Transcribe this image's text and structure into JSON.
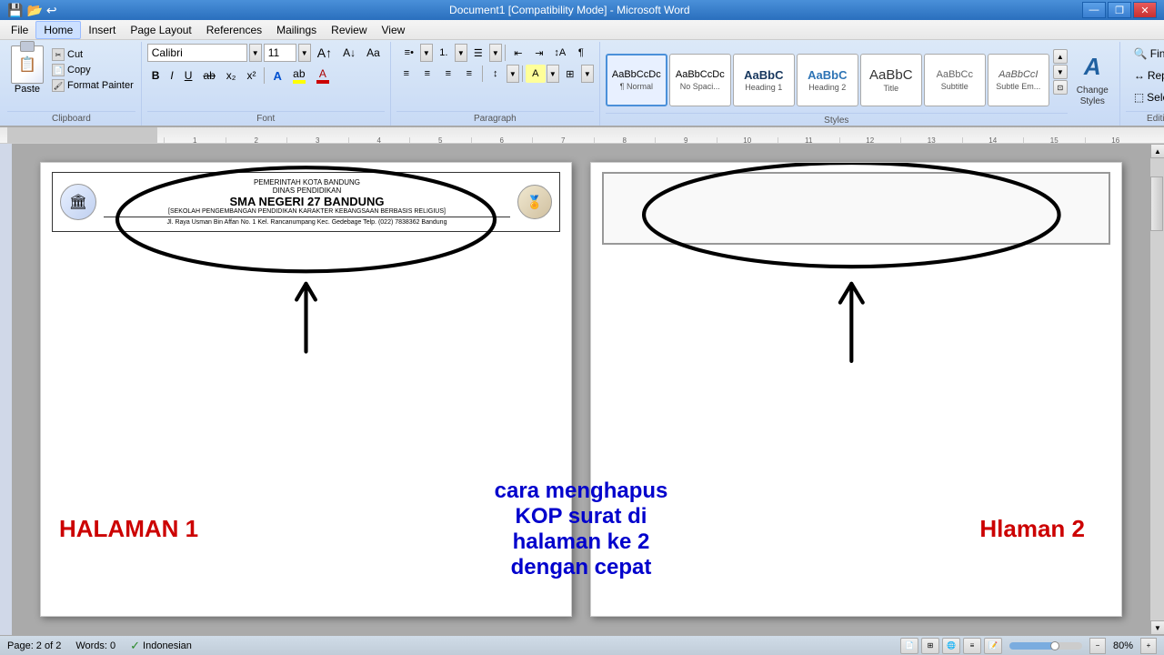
{
  "titlebar": {
    "title": "Document1 [Compatibility Mode] - Microsoft Word",
    "minimize": "—",
    "restore": "❐",
    "close": "✕"
  },
  "menubar": {
    "items": [
      {
        "label": "File",
        "active": false
      },
      {
        "label": "Home",
        "active": true
      },
      {
        "label": "Insert",
        "active": false
      },
      {
        "label": "Page Layout",
        "active": false
      },
      {
        "label": "References",
        "active": false
      },
      {
        "label": "Mailings",
        "active": false
      },
      {
        "label": "Review",
        "active": false
      },
      {
        "label": "View",
        "active": false
      }
    ]
  },
  "ribbon": {
    "clipboard": {
      "label": "Clipboard",
      "paste_label": "Paste",
      "cut_label": "Cut",
      "copy_label": "Copy",
      "format_painter_label": "Format Painter"
    },
    "font": {
      "label": "Font",
      "name": "Calibri",
      "size": "11",
      "bold": "B",
      "italic": "I",
      "underline": "U",
      "strikethrough": "ab",
      "subscript": "x₂",
      "superscript": "x²"
    },
    "paragraph": {
      "label": "Paragraph"
    },
    "styles": {
      "label": "Styles",
      "items": [
        {
          "name": "Normal",
          "preview": "AaBbCcDc",
          "active": true
        },
        {
          "name": "No Spaci...",
          "preview": "AaBbCcDc",
          "active": false
        },
        {
          "name": "Heading 1",
          "preview": "AaBbC",
          "active": false
        },
        {
          "name": "Heading 2",
          "preview": "AaBbC",
          "active": false
        },
        {
          "name": "Title",
          "preview": "AaBbC",
          "active": false
        },
        {
          "name": "Subtitle",
          "preview": "AaBbCc",
          "active": false
        },
        {
          "name": "Subtle Em...",
          "preview": "AaBbCcI",
          "active": false
        }
      ],
      "change_label": "Change\nStyles"
    },
    "editing": {
      "label": "Editing",
      "find_label": "Find",
      "replace_label": "Replace",
      "select_label": "Select"
    }
  },
  "document": {
    "page1": {
      "school_city": "PEMERINTAH KOTA BANDUNG",
      "dept": "DINAS PENDIDIKAN",
      "school_name": "SMA NEGERI 27 BANDUNG",
      "school_sub": "[SEKOLAH PENGEMBANGAN PENDIDIKAN KARAKTER KEBANGSAAN BERBASIS RELIGIUS]",
      "school_addr": "Jl. Raya Usman Bin Affan No. 1 Kel. Rancanumpang Kec. Gedebage Telp. (022) 7838362 Bandung",
      "label": "HALAMAN 1"
    },
    "page2": {
      "label": "Hlaman 2"
    },
    "center_text_line1": "cara menghapus",
    "center_text_line2": "KOP surat di",
    "center_text_line3": "halaman ke 2",
    "center_text_line4": "dengan cepat"
  },
  "statusbar": {
    "page": "Page: 2 of 2",
    "words": "Words: 0",
    "language": "Indonesian",
    "zoom": "80%"
  }
}
